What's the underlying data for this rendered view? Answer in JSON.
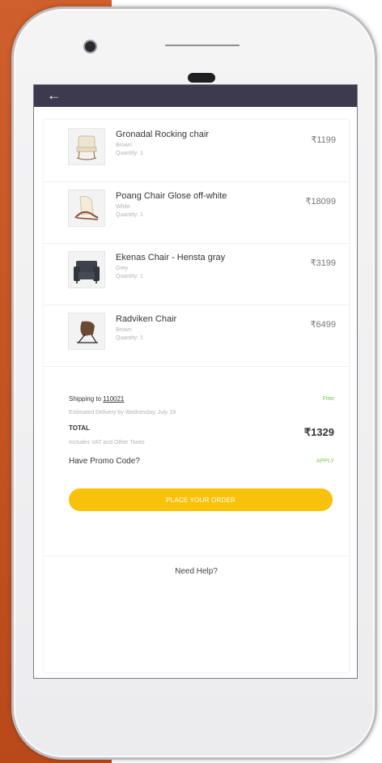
{
  "header": {
    "back_icon": "arrow-left-icon"
  },
  "items": [
    {
      "name": "Gronadal Rocking chair",
      "color": "Brown",
      "quantity": "Quantity: 1",
      "price": "₹1199",
      "icon": "rocking-chair-icon"
    },
    {
      "name": "Poang Chair Glose off-white",
      "color": "White",
      "quantity": "Quantity: 1",
      "price": "₹18099",
      "icon": "armchair-icon"
    },
    {
      "name": "Ekenas Chair - Hensta gray",
      "color": "Grey",
      "quantity": "Quantity: 1",
      "price": "₹3199",
      "icon": "sofa-chair-icon"
    },
    {
      "name": "Radviken Chair",
      "color": "Brown",
      "quantity": "Quantity: 1",
      "price": "₹6499",
      "icon": "lounge-chair-icon"
    }
  ],
  "summary": {
    "shipping_prefix": "Shipping to",
    "pincode": "110021",
    "shipping_cost": "Free",
    "delivery_estimate": "Estimated Delivery by Wednesday, July 19",
    "total_label": "TOTAL",
    "total_value": "₹1329",
    "tax_note": "Includes VAT and Other Taxes",
    "promo_label": "Have Promo Code?",
    "apply_label": "APPLY"
  },
  "actions": {
    "place_order": "PLACE YOUR ORDER",
    "need_help": "Need Help?"
  },
  "colors": {
    "appbar": "#3d3a4f",
    "accent_button": "#f9c20a",
    "free_text": "#7cc44f",
    "background_left": "#c2531f"
  }
}
